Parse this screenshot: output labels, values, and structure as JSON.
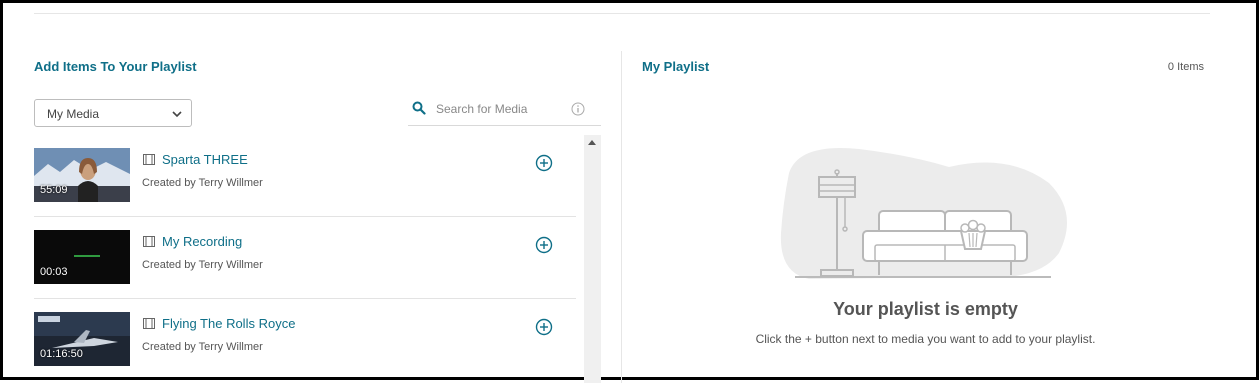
{
  "add_panel": {
    "title": "Add Items To Your Playlist",
    "source_select": {
      "value": "My Media"
    },
    "search": {
      "placeholder": "Search for Media"
    },
    "items": [
      {
        "title": "Sparta THREE",
        "creator": "Created by Terry Willmer",
        "duration": "55:09"
      },
      {
        "title": "My Recording",
        "creator": "Created by Terry Willmer",
        "duration": "00:03"
      },
      {
        "title": "Flying The Rolls Royce",
        "creator": "Created by Terry Willmer",
        "duration": "01:16:50"
      }
    ]
  },
  "playlist_panel": {
    "title": "My Playlist",
    "count": "0 Items",
    "empty_title": "Your playlist is empty",
    "empty_message": "Click the + button next to media you want to add to your playlist."
  },
  "colors": {
    "accent": "#0f6f88",
    "muted_text": "#555555",
    "divider": "#e6e6e6"
  },
  "icons": [
    "chevron-down-icon",
    "search-icon",
    "info-icon",
    "film-icon",
    "add-circle-icon",
    "empty-playlist-illustration"
  ]
}
